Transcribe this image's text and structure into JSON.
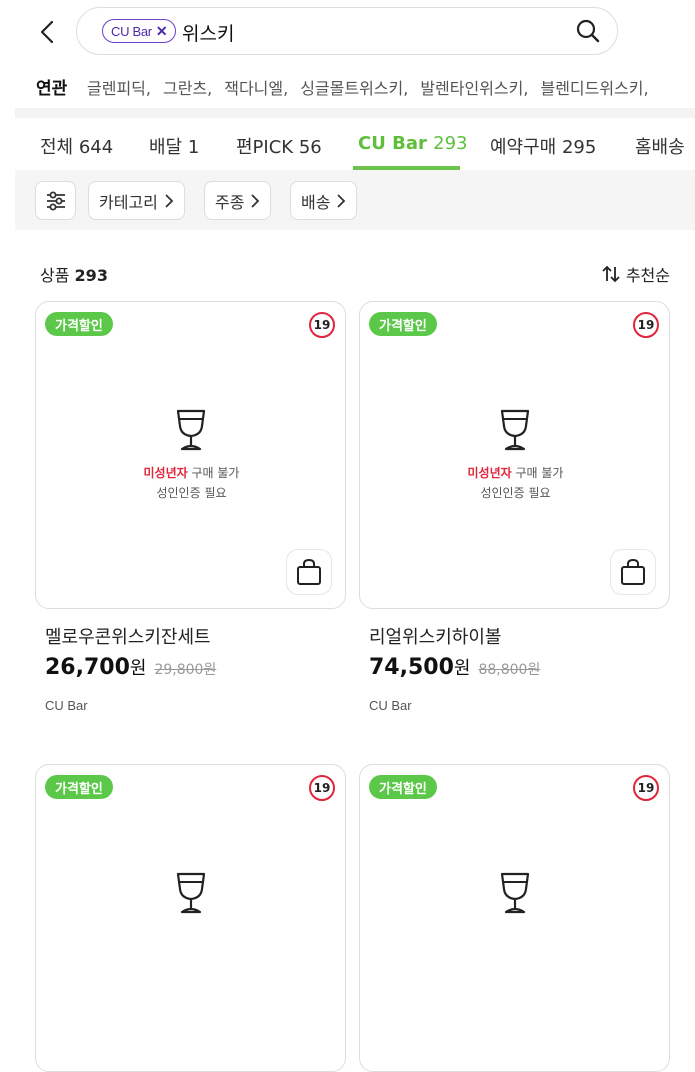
{
  "search": {
    "chip_label": "CU Bar",
    "chip_close": "✕",
    "query": "위스키"
  },
  "related": {
    "label": "연관",
    "items": [
      "글렌피딕,",
      "그란츠,",
      "잭다니엘,",
      "싱글몰트위스키,",
      "발렌타인위스키,",
      "블렌디드위스키,"
    ]
  },
  "tabs": [
    {
      "name": "전체",
      "count": "644"
    },
    {
      "name": "배달",
      "count": "1"
    },
    {
      "name": "편PICK",
      "count": "56"
    },
    {
      "name": "CU Bar",
      "count": "293",
      "active": true
    },
    {
      "name": "예약구매",
      "count": "295"
    },
    {
      "name": "홈배송",
      "count": ""
    }
  ],
  "filters": {
    "category": "카테고리",
    "liquor_type": "주종",
    "delivery": "배송"
  },
  "summary": {
    "label": "상품",
    "count": "293",
    "sort": "추천순"
  },
  "common": {
    "badge": "가격할인",
    "age": "19",
    "warn_red": "미성년자",
    "warn_rest": " 구매 불가",
    "warn2": "성인인증 필요",
    "currency": "원"
  },
  "products": [
    {
      "name": "멜로우콘위스키잔세트",
      "price": "26,700",
      "original": "29,800원",
      "store": "CU Bar"
    },
    {
      "name": "리얼위스키하이볼",
      "price": "74,500",
      "original": "88,800원",
      "store": "CU Bar"
    }
  ],
  "colors": {
    "accent": "#5cc84a",
    "chip": "#6b3fd0",
    "age_ring": "#e0253c"
  }
}
